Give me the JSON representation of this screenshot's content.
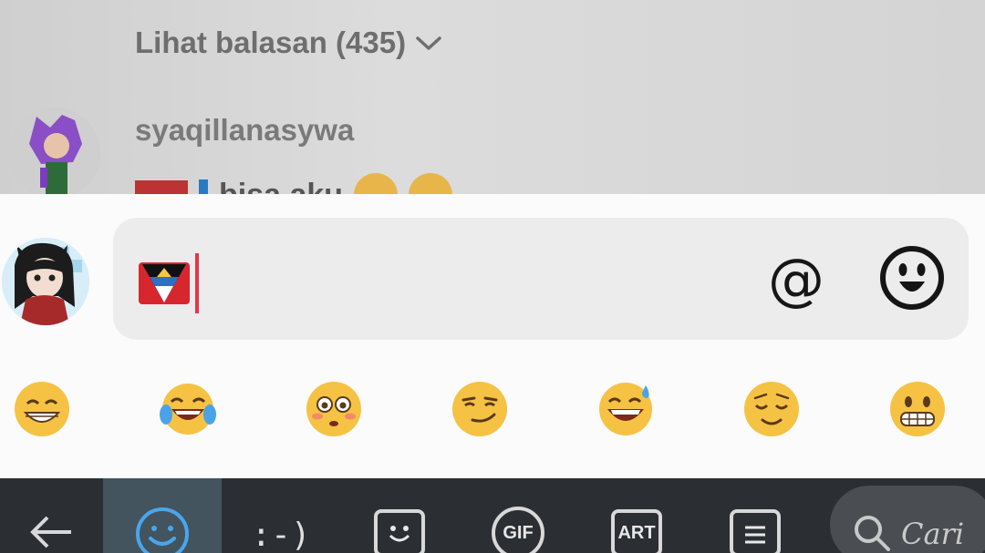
{
  "comments": {
    "view_replies": "Lihat balasan (435)",
    "reply_username": "syaqillanasywa",
    "reply_text": "bisa aku"
  },
  "composer": {
    "input_value_icon": "antigua-barbuda-flag-emoji",
    "mention_symbol": "@",
    "emoji_button_icon": "smiley-face-icon"
  },
  "quick_emojis": [
    "grinning-face-with-smiling-eyes",
    "face-with-tears-of-joy",
    "flushed-face",
    "smirking-face",
    "grinning-face-with-sweat",
    "relieved-face",
    "grimacing-face"
  ],
  "keyboard": {
    "gif_label": "GIF",
    "art_label": "ART",
    "emoticon_label": ":-)",
    "search_label": "Cari"
  },
  "colors": {
    "keyboard_bg": "#2b2f33",
    "keyboard_active": "#43545f",
    "input_bg": "#ececec",
    "caret": "#e0384a"
  }
}
